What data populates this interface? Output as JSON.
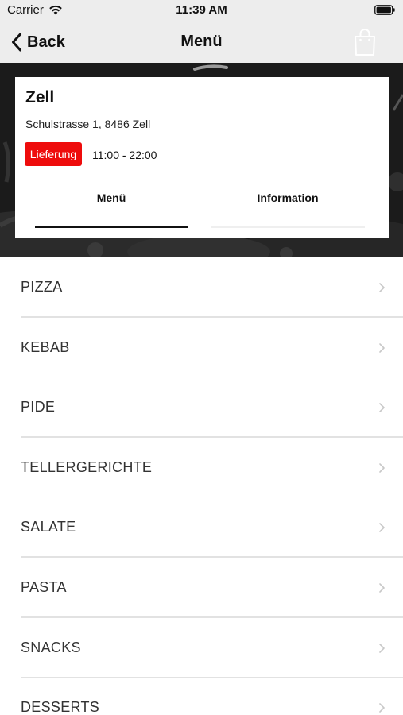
{
  "status_bar": {
    "carrier": "Carrier",
    "time": "11:39 AM",
    "wifi_icon": "wifi-icon",
    "battery_icon": "battery-icon"
  },
  "nav": {
    "back_label": "Back",
    "title": "Menü",
    "back_icon": "chevron-left-icon",
    "bag_icon": "shopping-bag-icon"
  },
  "shop": {
    "name": "Zell",
    "address": "Schulstrasse 1, 8486 Zell",
    "delivery_badge": "Lieferung",
    "hours": "11:00 - 22:00",
    "tabs": [
      {
        "label": "Menü",
        "active": true
      },
      {
        "label": "Information",
        "active": false
      }
    ]
  },
  "categories": [
    {
      "label": "PIZZA"
    },
    {
      "label": "KEBAB"
    },
    {
      "label": "PIDE"
    },
    {
      "label": "TELLERGERICHTE"
    },
    {
      "label": "SALATE"
    },
    {
      "label": "PASTA"
    },
    {
      "label": "SNACKS"
    },
    {
      "label": "DESSERTS"
    }
  ],
  "colors": {
    "accent_red": "#ee0c0c",
    "bar_background": "#ededed",
    "hero_dark": "#1b1b1b",
    "divider": "#e2e2e2",
    "chevron": "#c8c8c8"
  }
}
